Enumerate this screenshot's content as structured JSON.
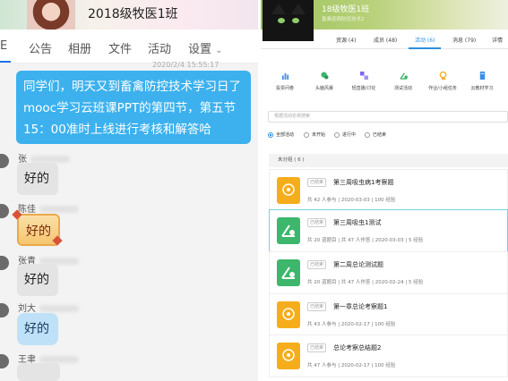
{
  "left": {
    "header_title": "2018级牧医1班",
    "tab_partial": "E",
    "tabs": [
      "公告",
      "相册",
      "文件",
      "活动",
      "设置"
    ],
    "timestamp": "2020/2/4 15:55:17",
    "announcement_lines": [
      "同学们，明天又到畜禽防控技术学习日了",
      "mooc学习云班课PPT的第四节，第五节",
      "15：00准时上线进行考核和解答哈"
    ],
    "messages": [
      {
        "sender": "张",
        "text": "好的",
        "style": "gray"
      },
      {
        "sender": "陈佳",
        "text": "好的",
        "style": "gold"
      },
      {
        "sender": "张青",
        "text": "好的",
        "style": "gray"
      },
      {
        "sender": "刘大",
        "text": "好的",
        "style": "blue"
      },
      {
        "sender": "王聿",
        "text": "",
        "style": "gray"
      }
    ]
  },
  "right": {
    "class_title": "18级牧医1班",
    "class_subtitle": "畜禽疫病防控技术2",
    "nav": [
      {
        "label": "资源 (4)",
        "active": false
      },
      {
        "label": "成员 (48)",
        "active": false
      },
      {
        "label": "活动 (6)",
        "active": true
      },
      {
        "label": "消息 (79)",
        "active": false
      },
      {
        "label": "详情",
        "active": false
      }
    ],
    "tools": [
      {
        "label": "投票问卷",
        "icon": "bar-chart-icon",
        "color": "#3a8ee6"
      },
      {
        "label": "头脑风暴",
        "icon": "brainstorm-icon",
        "color": "#3cb76b"
      },
      {
        "label": "轻直播/讨论",
        "icon": "live-discussion-icon",
        "color": "#7b68ee"
      },
      {
        "label": "测试活动",
        "icon": "test-activity-icon",
        "color": "#3cb76b"
      },
      {
        "label": "作业/小组任务",
        "icon": "homework-icon",
        "color": "#f6ad1b"
      },
      {
        "label": "云教材学习",
        "icon": "book-icon",
        "color": "#3a8ee6"
      }
    ],
    "search_placeholder": "根据活动名称搜索",
    "filters": [
      {
        "label": "全部活动",
        "selected": true
      },
      {
        "label": "未开始",
        "selected": false
      },
      {
        "label": "进行中",
        "selected": false
      },
      {
        "label": "已结束",
        "selected": false
      }
    ],
    "group_label": "未分组 ( 6 )",
    "tasks": [
      {
        "badge": "已结束",
        "title": "第三周吸虫病1考察题",
        "meta": "共 42 人参与  |  2020-03-03  |  100 经验",
        "kind": "orange"
      },
      {
        "badge": "已结束",
        "title": "第三周吸虫1测试",
        "meta": "共 20 道题目  |  共 47 人作答  |  2020-03-03  |  5 经验",
        "kind": "green"
      },
      {
        "badge": "已结束",
        "title": "第二周总论测试题",
        "meta": "共 20 道题目  |  共 47 人作答  |  2020-02-24  |  5 经验",
        "kind": "green"
      },
      {
        "badge": "已结束",
        "title": "第一章总论考察题1",
        "meta": "共 43 人参与  |  2020-02-17  |  100 经验",
        "kind": "orange"
      },
      {
        "badge": "已结束",
        "title": "总论考察总结题2",
        "meta": "共 47 人参与  |  2020-02-17  |  100 经验",
        "kind": "orange"
      }
    ]
  }
}
